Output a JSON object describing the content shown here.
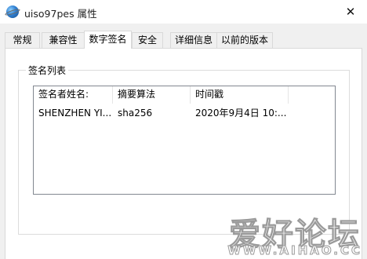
{
  "window": {
    "title": "uiso97pes 属性",
    "close_glyph": "✕"
  },
  "tabs": [
    {
      "label": "常规"
    },
    {
      "label": "兼容性"
    },
    {
      "label": "数字签名",
      "active": true
    },
    {
      "label": "安全"
    },
    {
      "label": "详细信息"
    },
    {
      "label": "以前的版本"
    }
  ],
  "signature_list": {
    "group_label": "签名列表",
    "columns": [
      "签名者姓名:",
      "摘要算法",
      "时间戳"
    ],
    "rows": [
      [
        "SHENZHEN YI...",
        "sha256",
        "2020年9月4日 10:..."
      ]
    ]
  },
  "watermark": {
    "text": "爱好论坛",
    "url_text": "WWW.AIHAO.CC"
  }
}
